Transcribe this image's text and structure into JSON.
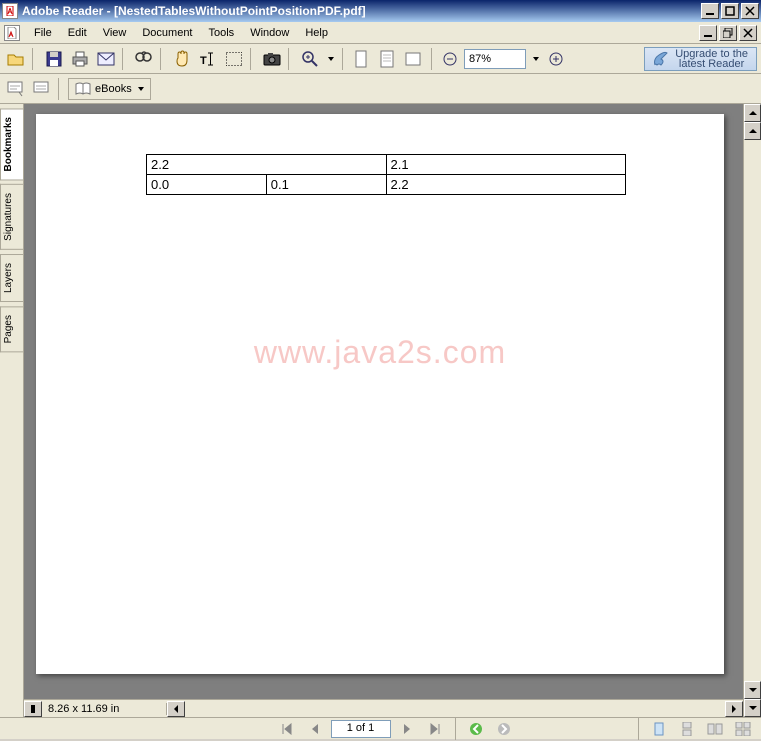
{
  "title": "Adobe Reader - [NestedTablesWithoutPointPositionPDF.pdf]",
  "menu": {
    "file": "File",
    "edit": "Edit",
    "view": "View",
    "document": "Document",
    "tools": "Tools",
    "window": "Window",
    "help": "Help"
  },
  "toolbar": {
    "zoom_value": "87%",
    "upgrade_line1": "Upgrade to the",
    "upgrade_line2": "latest Reader",
    "ebooks": "eBooks"
  },
  "tabs": {
    "bookmarks": "Bookmarks",
    "signatures": "Signatures",
    "layers": "Layers",
    "pages": "Pages"
  },
  "document": {
    "table": {
      "r1": {
        "c1": "2.2",
        "c2": "2.1"
      },
      "r2": {
        "c1": "0.0",
        "c2": "0.1",
        "c3": "2.2"
      }
    },
    "watermark": "www.java2s.com"
  },
  "status": {
    "dimensions": "8.26 x 11.69 in",
    "page": "1 of 1"
  }
}
